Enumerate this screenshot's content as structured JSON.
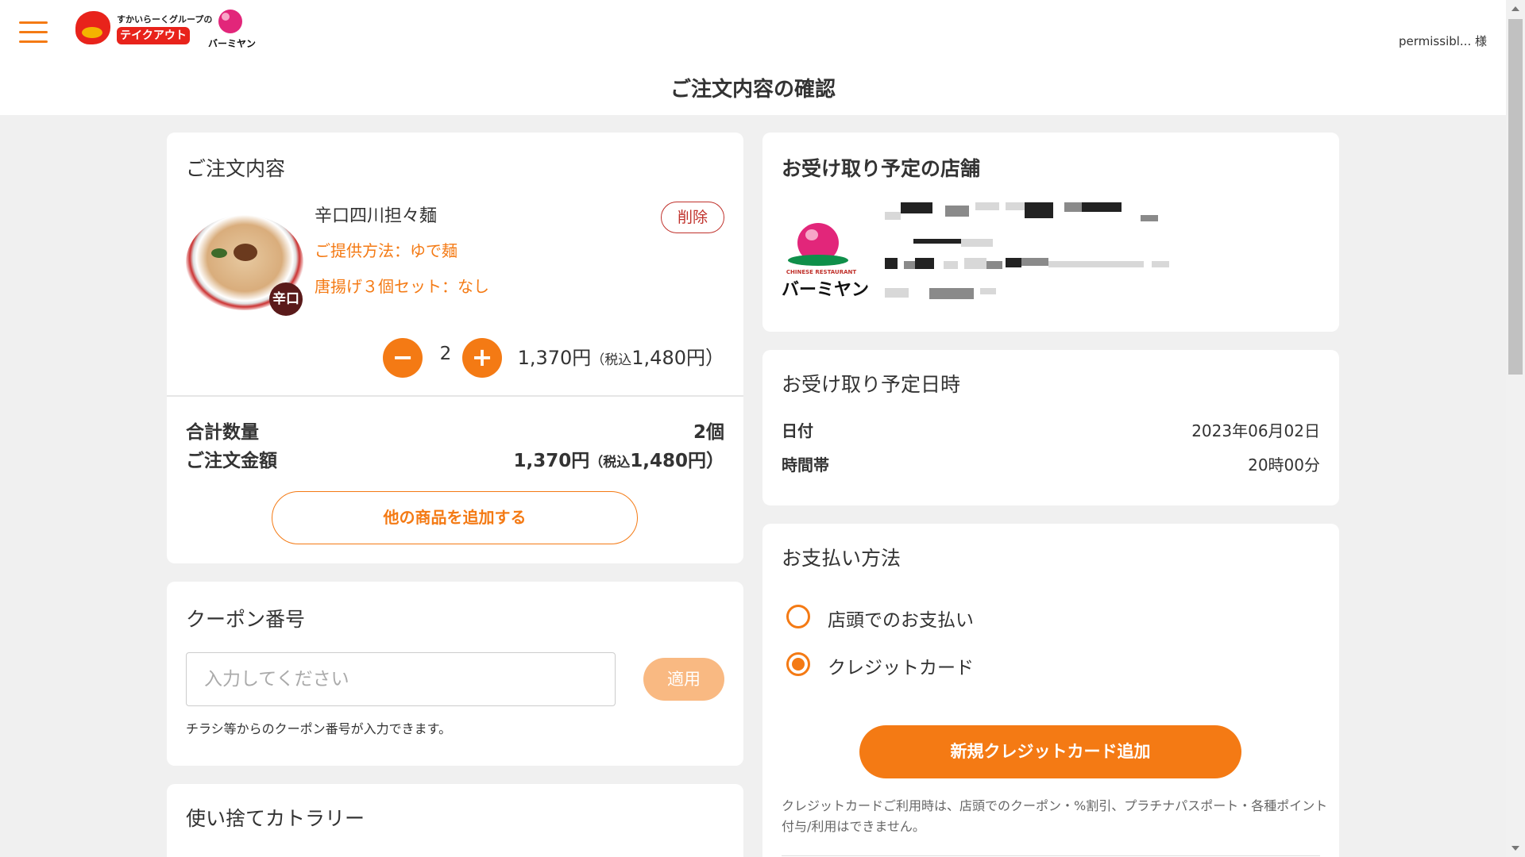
{
  "header": {
    "logo_group_text": "すかいらーくグループの",
    "logo_takeout": "テイクアウト",
    "logo_brand": "バーミヤン",
    "user_name": "permissibl... 様",
    "page_title": "ご注文内容の確認"
  },
  "order": {
    "title": "ご注文内容",
    "item": {
      "name": "辛口四川担々麺",
      "option1": "ご提供方法：ゆで麺",
      "option2": "唐揚げ３個セット：なし",
      "badge": "辛口",
      "delete_label": "削除",
      "minus_label": "−",
      "plus_label": "+",
      "quantity": "2",
      "price": "1,370円",
      "tax_prefix": "（税込",
      "tax_price": "1,480円）"
    },
    "summary": {
      "qty_label": "合計数量",
      "qty_value": "2個",
      "amount_label": "ご注文金額",
      "amount_value": "1,370円",
      "amount_tax_prefix": "（税込",
      "amount_tax": "1,480円）"
    },
    "add_more_label": "他の商品を追加する"
  },
  "coupon": {
    "title": "クーポン番号",
    "placeholder": "入力してください",
    "apply_label": "適用",
    "note": "チラシ等からのクーポン番号が入力できます。"
  },
  "cutlery": {
    "title": "使い捨てカトラリー"
  },
  "store": {
    "title": "お受け取り予定の店舗",
    "logo_sub": "CHINESE RESTAURANT",
    "logo_name": "バーミヤン"
  },
  "pickup": {
    "title": "お受け取り予定日時",
    "date_label": "日付",
    "date_value": "2023年06月02日",
    "time_label": "時間帯",
    "time_value": "20時00分"
  },
  "payment": {
    "title": "お支払い方法",
    "options": [
      {
        "label": "店頭でのお支払い",
        "checked": false
      },
      {
        "label": "クレジットカード",
        "checked": true
      }
    ],
    "new_card_label": "新規クレジットカード追加",
    "note": "クレジットカードご利用時は、店頭でのクーポン・%割引、プラチナパスポート・各種ポイント付与/利用はできません。"
  },
  "colors": {
    "accent": "#f47a14",
    "danger": "#c0312b",
    "background": "#f0f0f0"
  }
}
